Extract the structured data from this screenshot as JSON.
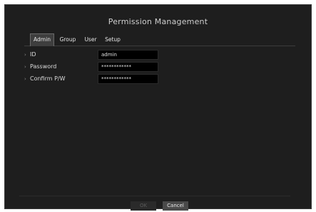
{
  "window": {
    "title": "Permission Management"
  },
  "tabs": [
    {
      "label": "Admin",
      "active": true
    },
    {
      "label": "Group",
      "active": false
    },
    {
      "label": "User",
      "active": false
    },
    {
      "label": "Setup",
      "active": false
    }
  ],
  "form": {
    "bullet": "›",
    "id_label": "ID",
    "id_value": "admin",
    "password_label": "Password",
    "password_value": "************",
    "confirm_label": "Confirm P/W",
    "confirm_value": "************"
  },
  "footer": {
    "ok_label": "OK",
    "ok_enabled": false,
    "cancel_label": "Cancel"
  },
  "colors": {
    "background": "#1e1e1e",
    "active_tab": "#3e3e3e",
    "field_background": "#000000",
    "cancel_button": "#4a4a4a"
  }
}
